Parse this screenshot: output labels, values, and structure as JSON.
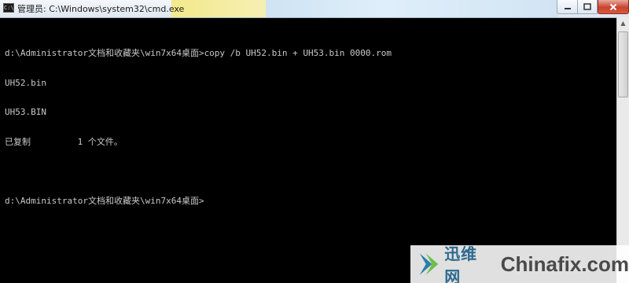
{
  "window": {
    "title": "管理员: C:\\Windows\\system32\\cmd.exe",
    "icon_name": "cmd-icon",
    "icon_label": "C:\\",
    "controls": {
      "minimize_icon": "minimize-icon",
      "maximize_icon": "maximize-icon",
      "close_icon": "close-icon"
    }
  },
  "console": {
    "lines": [
      "d:\\Administrator文档和收藏夹\\win7x64桌面>copy /b UH52.bin + UH53.bin 0000.rom",
      "UH52.bin",
      "UH53.BIN",
      "已复制         1 个文件。",
      "",
      "d:\\Administrator文档和收藏夹\\win7x64桌面>"
    ],
    "text_color": "#c8c8c8",
    "background_color": "#000000"
  },
  "watermark": {
    "cn_text": "迅维网",
    "en_text": "Chinafix.com",
    "logo_icon": "arrow-logo-icon"
  }
}
